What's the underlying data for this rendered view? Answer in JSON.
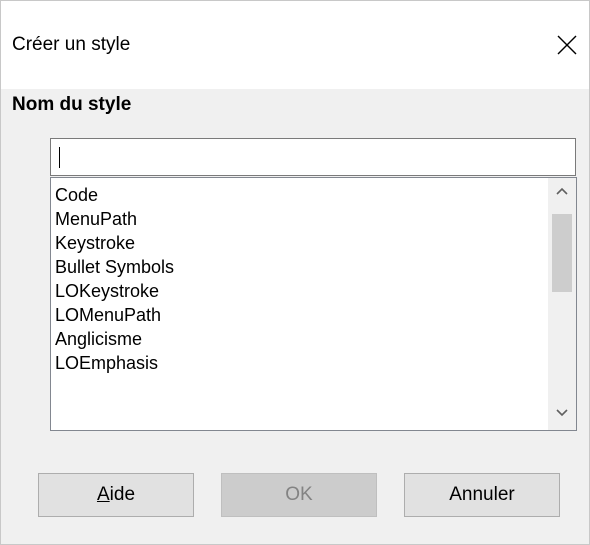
{
  "window": {
    "title": "Créer un style",
    "close_icon": "close-icon"
  },
  "form": {
    "style_name_label": "Nom du style",
    "style_name_value": "",
    "styles": [
      "Code",
      "MenuPath",
      "Keystroke",
      "Bullet Symbols",
      "LOKeystroke",
      "LOMenuPath",
      "Anglicisme",
      "LOEmphasis"
    ]
  },
  "buttons": {
    "help_mnemonic": "A",
    "help_rest": "ide",
    "ok": "OK",
    "cancel": "Annuler"
  },
  "colors": {
    "dialog_bg": "#f0f0f0",
    "disabled_text": "#838383"
  }
}
